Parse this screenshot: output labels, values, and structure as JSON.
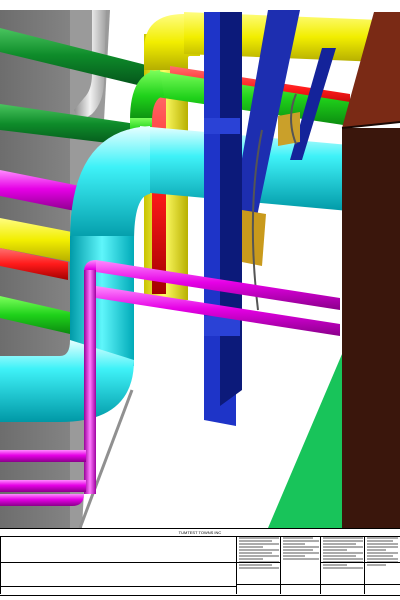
{
  "title_block": {
    "drawing_title": "TUMTEST TOWNS INC"
  },
  "colors": {
    "cyan_pipe": "#00e5ee",
    "magenta_pipe": "#e600e6",
    "green_pipe": "#0c9a2a",
    "red_pipe": "#ff1a1a",
    "yellow_pipe": "#f2ee00",
    "steel_beam": "#1a2fb8",
    "wall": "#7a7a7a",
    "equipment": "#4a1a0e",
    "floor_green": "#18c45a",
    "support_block": "#c99a1c"
  }
}
